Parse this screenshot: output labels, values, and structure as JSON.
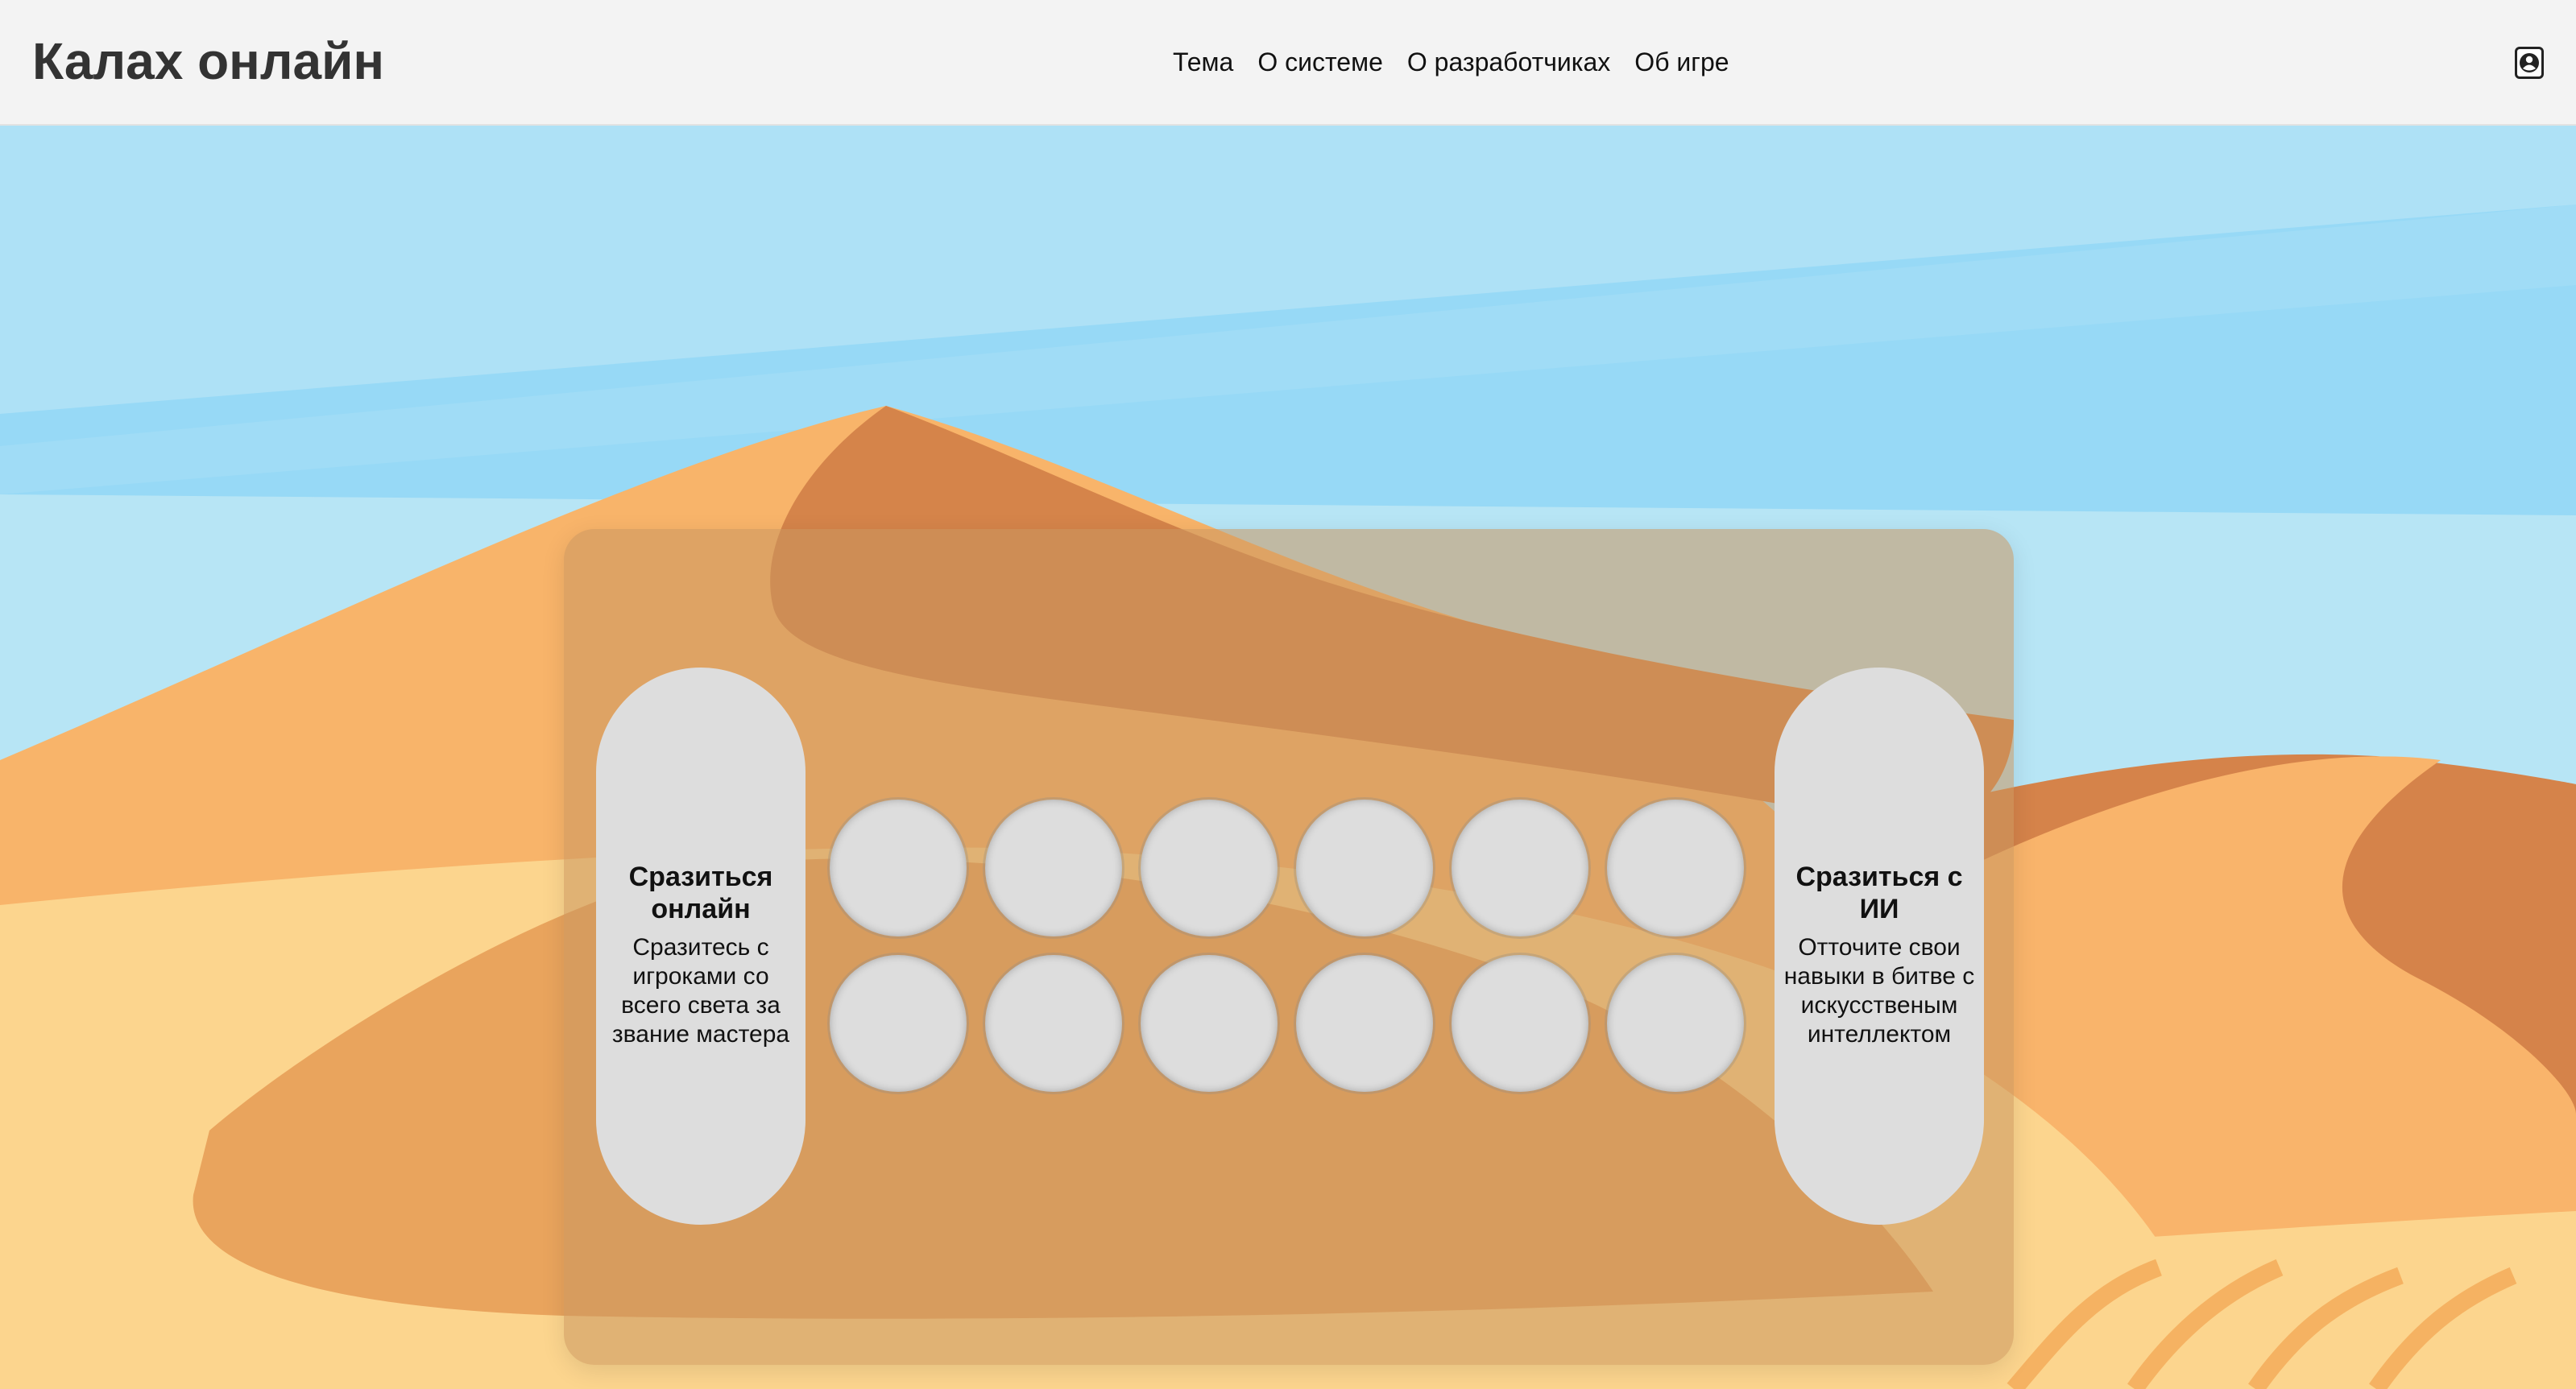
{
  "header": {
    "title": "Калах онлайн",
    "nav": [
      "Тема",
      "О системе",
      "О разработчиках",
      "Об игре"
    ],
    "account_icon": "account-circle-icon"
  },
  "board": {
    "left_store": {
      "title": "Сразиться онлайн",
      "description": "Сразитесь с игроками со всего света за звание мастера"
    },
    "right_store": {
      "title": "Сразиться с ИИ",
      "description": "Отточите свои навыки в битве с искусственым интеллектом"
    },
    "pits": [
      {
        "id": "pit-1"
      },
      {
        "id": "pit-2"
      },
      {
        "id": "pit-3"
      },
      {
        "id": "pit-4"
      },
      {
        "id": "pit-5"
      },
      {
        "id": "pit-6"
      },
      {
        "id": "pit-7"
      },
      {
        "id": "pit-8"
      },
      {
        "id": "pit-9"
      },
      {
        "id": "pit-10"
      },
      {
        "id": "pit-11"
      },
      {
        "id": "pit-12"
      }
    ]
  },
  "colors": {
    "sky": "#a8e0f7",
    "sand_light": "#fbd58f",
    "sand_mid": "#f8b46a",
    "sand_dark": "#d28148",
    "header_bg": "#f3f3f3"
  }
}
